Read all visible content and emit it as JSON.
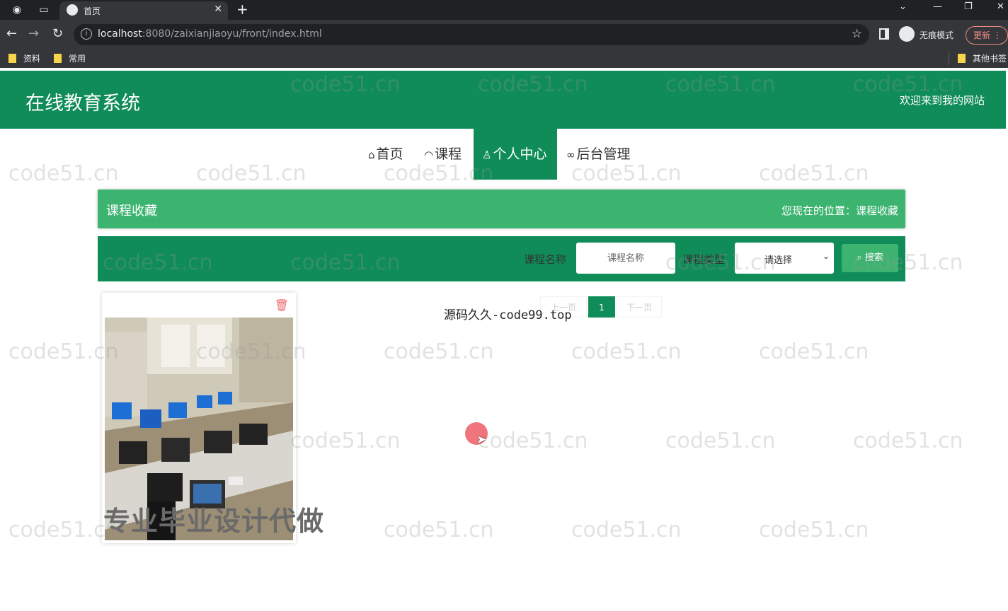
{
  "browser": {
    "tab_title": "首页",
    "url_host": "localhost",
    "url_rest": ":8080/zaixianjiaoyu/front/index.html",
    "incognito_label": "无痕模式",
    "update_label": "更新",
    "bookmarks": [
      "资料",
      "常用"
    ],
    "other_bookmarks": "其他书签"
  },
  "header": {
    "title": "在线教育系统",
    "welcome": "欢迎来到我的网站"
  },
  "nav": {
    "items": [
      {
        "icon": "home-icon",
        "label": "首页"
      },
      {
        "icon": "dashboard-icon",
        "label": "课程"
      },
      {
        "icon": "user-icon",
        "label": "个人中心"
      },
      {
        "icon": "link-icon",
        "label": "后台管理"
      }
    ],
    "active_index": 2
  },
  "breadcrumb": {
    "title": "课程收藏",
    "position": "您现在的位置：课程收藏"
  },
  "search": {
    "name_label": "课程名称",
    "name_placeholder": "课程名称",
    "type_label": "课程类型",
    "type_selected": "请选择",
    "button_label": "搜索"
  },
  "pager": {
    "prev": "上一页",
    "current": "1",
    "next": "下一页"
  },
  "overlays": {
    "source_text": "源码久久-code99.top",
    "promo_text": "专业毕业设计代做",
    "watermark": "code51.cn"
  },
  "colors": {
    "primary": "#0f8c58",
    "secondary": "#3cb470"
  }
}
